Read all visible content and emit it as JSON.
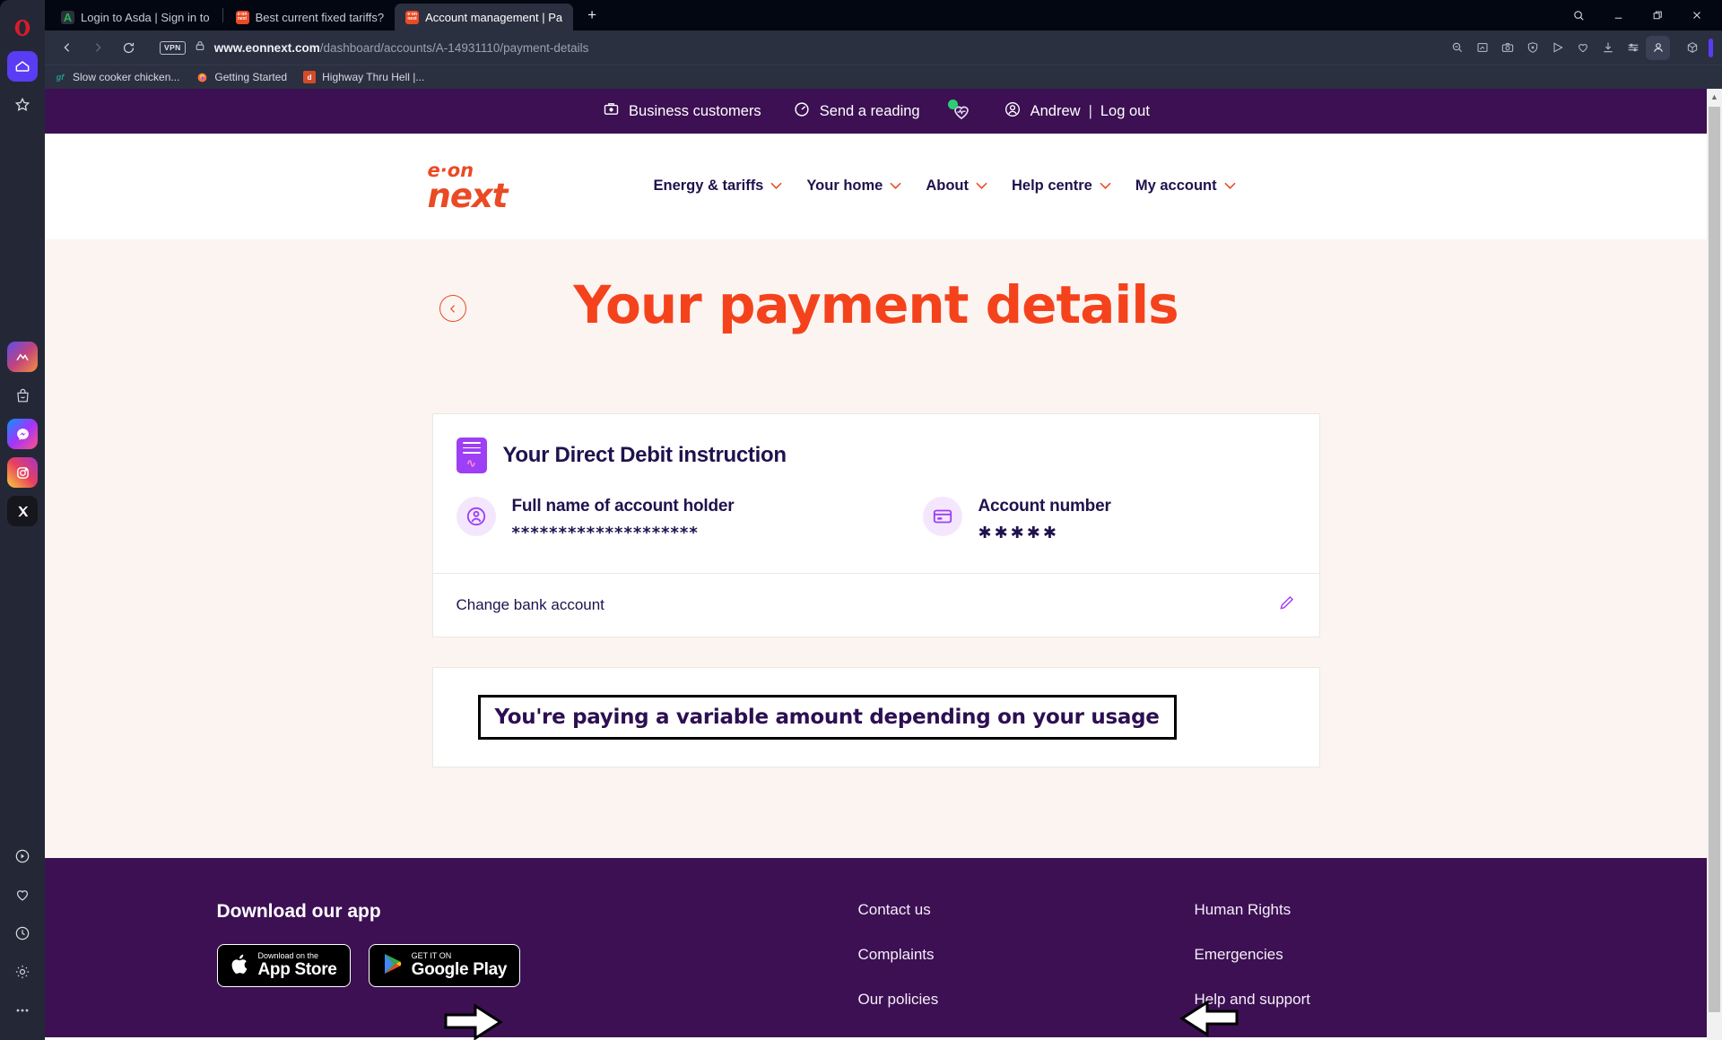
{
  "browser": {
    "rail": [
      {
        "name": "opera-menu-icon",
        "glyph": "O"
      },
      {
        "name": "home-icon",
        "glyph": "home"
      },
      {
        "name": "favorites-star-icon",
        "glyph": "star"
      },
      {
        "name": "ai-sidebar-icon",
        "glyph": "aria"
      },
      {
        "name": "shopping-bag-icon",
        "glyph": "bag"
      },
      {
        "name": "messenger-icon",
        "glyph": "messenger"
      },
      {
        "name": "instagram-icon",
        "glyph": "instagram"
      },
      {
        "name": "x-twitter-icon",
        "glyph": "x"
      },
      {
        "name": "player-icon",
        "glyph": "play"
      },
      {
        "name": "pinboard-heart-icon",
        "glyph": "heart"
      },
      {
        "name": "history-icon",
        "glyph": "clock"
      },
      {
        "name": "settings-gear-icon",
        "glyph": "gear"
      },
      {
        "name": "more-icon",
        "glyph": "dots"
      }
    ],
    "tabs": [
      {
        "title": "Login to Asda | Sign in to",
        "favicon": "A",
        "favicon_bg": "#2b3040",
        "favicon_color": "#2bb34a",
        "active": false
      },
      {
        "title": "Best current fixed tariffs?",
        "favicon": "eon",
        "favicon_bg": "#ea4a24",
        "favicon_color": "#ffffff",
        "active": false
      },
      {
        "title": "Account management | Pa",
        "favicon": "eon",
        "favicon_bg": "#ea4a24",
        "favicon_color": "#ffffff",
        "active": true
      }
    ],
    "new_tab_label": "+",
    "window_controls": [
      "search",
      "minimize",
      "restore",
      "close"
    ],
    "address": {
      "vpn_badge": "VPN",
      "url_domain": "www.eonnext.com",
      "url_path": "/dashboard/accounts/A-14931110/payment-details"
    },
    "toolbar_icons": [
      "zoom-out-icon",
      "snapshot-edit-icon",
      "camera-icon",
      "shield-block-icon",
      "send-icon",
      "heart-icon",
      "download-icon",
      "easy-setup-icon",
      "profile-icon"
    ],
    "extension_icon": "cube-icon",
    "bookmarks": [
      {
        "label": "Slow cooker chicken...",
        "favicon": "gf",
        "bg": "#2b3040",
        "color": "#1e9e8a"
      },
      {
        "label": "Getting Started",
        "favicon": "🦊",
        "bg": "transparent",
        "color": "#ff8c3b"
      },
      {
        "label": "Highway Thru Hell |...",
        "favicon": "d",
        "bg": "#d44b2a",
        "color": "#ffffff"
      }
    ]
  },
  "site": {
    "utility_bar": {
      "business": "Business customers",
      "reading": "Send a reading",
      "health_icon": "heart-pulse-icon",
      "user": "Andrew",
      "separator": "|",
      "logout": "Log out"
    },
    "logo": {
      "line1": "e·on",
      "line2": "next"
    },
    "nav": [
      {
        "label": "Energy & tariffs",
        "chevron": "⌄"
      },
      {
        "label": "Your home",
        "chevron": "⌄"
      },
      {
        "label": "About",
        "chevron": "⌄"
      },
      {
        "label": "Help centre",
        "chevron": "⌄"
      },
      {
        "label": "My account",
        "chevron": "⌄"
      }
    ],
    "hero": {
      "back_icon": "chevron-left-icon",
      "title": "Your payment details"
    },
    "direct_debit_card": {
      "icon": "direct-debit-document-icon",
      "heading": "Your Direct Debit instruction",
      "fields": [
        {
          "icon": "person-circle-icon",
          "label": "Full name of account holder",
          "value": "********************"
        },
        {
          "icon": "credit-card-icon",
          "label": "Account number",
          "value": "✱✱✱✱✱"
        }
      ],
      "change_row": {
        "label": "Change bank account",
        "icon": "pencil-edit-icon"
      }
    },
    "payment_card": {
      "annotation_text": "You're paying a variable amount depending on your usage",
      "left_arrow_icon": "arrow-right-annotation-icon",
      "right_arrow_icon": "arrow-left-annotation-icon"
    },
    "footer": {
      "app_heading": "Download our app",
      "app_store": {
        "top": "Download on the",
        "main": "App Store",
        "icon": "apple-icon"
      },
      "google_play": {
        "top": "GET IT ON",
        "main": "Google Play",
        "icon": "google-play-icon"
      },
      "links_col1": [
        "Contact us",
        "Complaints",
        "Our policies"
      ],
      "links_col2": [
        "Human Rights",
        "Emergencies",
        "Help and support"
      ]
    }
  },
  "colors": {
    "brand_orange": "#f4431c",
    "brand_purple": "#3c1053",
    "accent_violet": "#9d3ff5",
    "page_bg": "#fbf4f1"
  }
}
